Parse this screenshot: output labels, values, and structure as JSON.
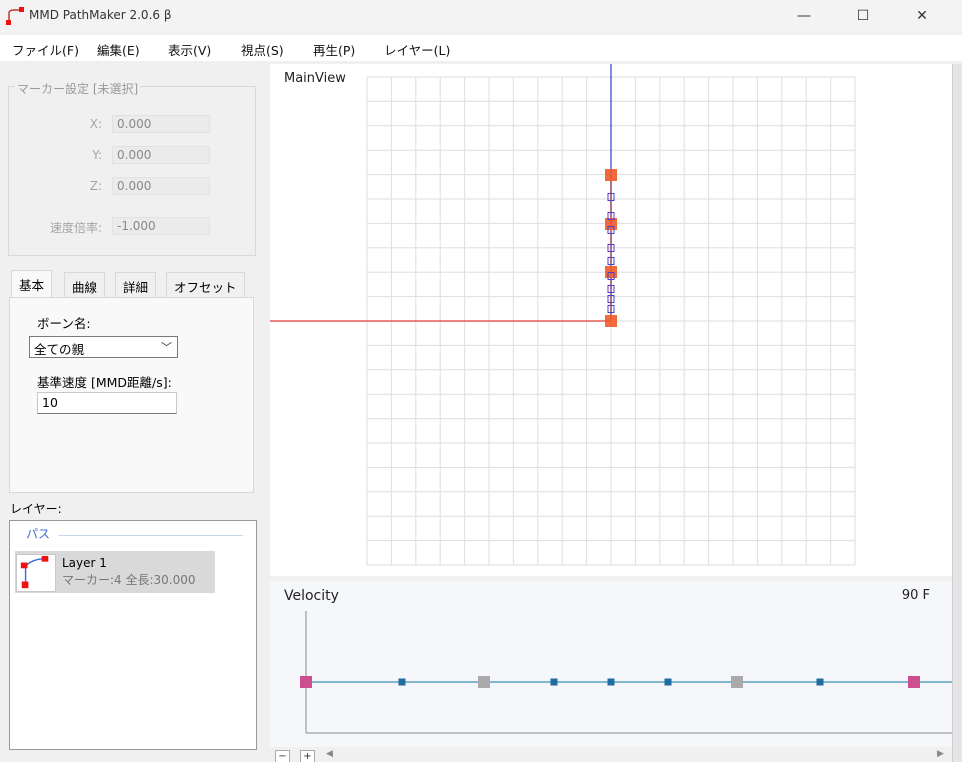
{
  "window": {
    "title": "MMD PathMaker 2.0.6 β",
    "minimize_glyph": "—",
    "maximize_glyph": "☐",
    "close_glyph": "✕"
  },
  "menu": {
    "items": [
      "ファイル(F)",
      "編集(E)",
      "表示(V)",
      "視点(S)",
      "再生(P)",
      "レイヤー(L)"
    ]
  },
  "marker_settings": {
    "legend": "マーカー設定 [未選択]",
    "x_label": "X:",
    "x_value": "0.000",
    "y_label": "Y:",
    "y_value": "0.000",
    "z_label": "Z:",
    "z_value": "0.000",
    "speed_label": "速度倍率:",
    "speed_value": "-1.000"
  },
  "tabs": [
    "基本",
    "曲線",
    "詳細",
    "オフセット"
  ],
  "basic_tab": {
    "bone_label": "ボーン名:",
    "bone_value": "全ての親",
    "speed_label": "基準速度 [MMD距離/s]:",
    "speed_value": "10"
  },
  "layers": {
    "label": "レイヤー:",
    "group_header": "パス",
    "items": [
      {
        "name": "Layer 1",
        "info": "マーカー:4 全長:30.000"
      }
    ]
  },
  "main_view": {
    "label": "MainView"
  },
  "velocity": {
    "label": "Velocity",
    "frames": "90 F"
  },
  "controls": {
    "minus": "−",
    "plus": "+",
    "scroll_left": "◀",
    "scroll_right": "▶"
  },
  "colors": {
    "x_axis": "#e53935",
    "y_axis": "#2f3fd8",
    "marker": "#f05a28",
    "control_point": "#4b3fd1",
    "velocity_line": "#5aa1c2",
    "velocity_key": "#cc4f8f",
    "velocity_mid": "#aaaaaa",
    "velocity_dot": "#1e6ea0",
    "path_header": "#3a6bd6"
  }
}
